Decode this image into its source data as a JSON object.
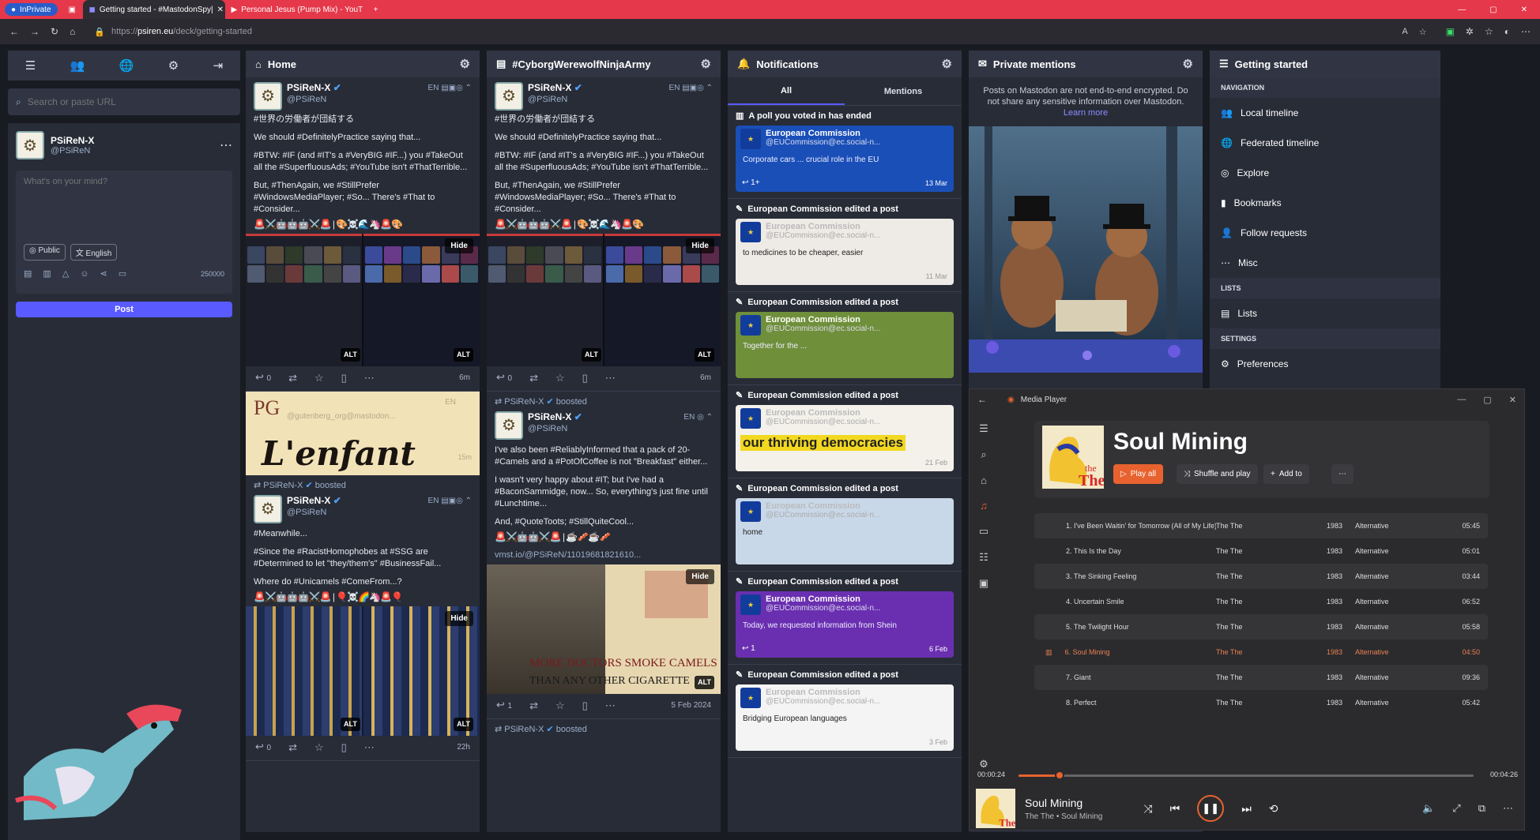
{
  "browser": {
    "inprivate": "InPrivate",
    "tabs": [
      {
        "title": "Getting started - #MastodonSpy|"
      },
      {
        "title": "Personal Jesus (Pump Mix) - YouT"
      }
    ],
    "url_prefix": "https://",
    "url_host": "psiren.eu",
    "url_path": "/deck/getting-started"
  },
  "compose": {
    "search_placeholder": "Search or paste URL",
    "profile_name": "PSiReN-X",
    "profile_handle": "@PSiReN",
    "textarea_placeholder": "What's on your mind?",
    "visibility": "Public",
    "language": "English",
    "char_count": "250000",
    "post_label": "Post"
  },
  "home": {
    "title": "Home",
    "post1": {
      "name": "PSiReN-X",
      "handle": "@PSiReN",
      "lang": "EN",
      "line1": "#世界の労働者が団結する",
      "p1": "We should #DefinitelyPractice saying that...",
      "p2": "#BTW: #IF (and #IT's a #VeryBIG #IF...) you #TakeOut all the #SuperfluousAds; #YouTube isn't #ThatTerrible...",
      "p3": "But, #ThenAgain, we #StillPrefer #WindowsMediaPlayer; #So... There's #That to #Consider...",
      "emoji": "🚨⚔️🤖🤖🤖⚔️🚨 | 🎨☠️🌊🦄🚨🎨",
      "hide": "Hide",
      "alt": "ALT",
      "replies": "0",
      "time": "6m"
    },
    "post2_card": {
      "site": "@gutenberg_org@mastodon...",
      "script": "L'enfant",
      "logo": "PG",
      "time": "15m",
      "lang": "EN"
    },
    "boost_by": "PSiReN-X",
    "boosted": "boosted",
    "post3": {
      "name": "PSiReN-X",
      "handle": "@PSiReN",
      "lang": "EN",
      "p1": "#Meanwhile...",
      "p2": "#Since the #RacistHomophobes at #SSG are #Determined to let \"they/them's\" #BusinessFail...",
      "p3": "Where do #Unicamels #ComeFrom...?",
      "emoji": "🚨⚔️🤖🤖🤖⚔️🚨 | 🎈☠️🌈🦄🚨🎈",
      "hide": "Hide",
      "alt": "ALT",
      "replies": "0",
      "time": "22h"
    }
  },
  "cyborg": {
    "title": "#CyborgWerewolfNinjaArmy",
    "post1": {
      "name": "PSiReN-X",
      "handle": "@PSiReN",
      "lang": "EN",
      "line1": "#世界の労働者が団結する",
      "p1": "We should #DefinitelyPractice saying that...",
      "p2": "#BTW: #IF (and #IT's a #VeryBIG #IF...) you #TakeOut all the #SuperfluousAds; #YouTube isn't #ThatTerrible...",
      "p3": "But, #ThenAgain, we #StillPrefer #WindowsMediaPlayer; #So... There's #That to #Consider...",
      "emoji": "🚨⚔️🤖🤖🤖⚔️🚨 | 🎨☠️🌊🦄🚨🎨",
      "hide": "Hide",
      "alt": "ALT",
      "replies": "0",
      "time": "6m"
    },
    "boost_by": "PSiReN-X",
    "boosted": "boosted",
    "post2": {
      "name": "PSiReN-X",
      "handle": "@PSiReN",
      "lang": "EN",
      "p1": "I've also been #ReliablyInformed that a pack of 20-#Camels and a #PotOfCoffee is not \"Breakfast\" either...",
      "p2": "I wasn't very happy about #IT; but I've had a #BaconSammidge, now... So, everything's just fine until #Lunchtime...",
      "p3": "And, #QuoteToots; #StillQuiteCool...",
      "emoji": "🚨⚔️🤖🤖⚔️🚨 | ☕🥓☕🥓",
      "link": "vmst.io/@PSiReN/11019681821610...",
      "ad1": "MORE DOCTORS SMOKE CAMELS",
      "ad2": "THAN ANY OTHER CIGARETTE",
      "hide": "Hide",
      "alt": "ALT",
      "replies": "1",
      "time": "5 Feb 2024"
    },
    "boost_by2": "PSiReN-X",
    "boosted2": "boosted"
  },
  "notifications": {
    "title": "Notifications",
    "tab_all": "All",
    "tab_mentions": "Mentions",
    "items": [
      {
        "header": "A poll you voted in has ended",
        "name": "European Commission",
        "handle": "@EUCommission@ec.social-n...",
        "overlay": "Corporate cars ... crucial role in the EU",
        "date": "13 Mar",
        "count": "1+",
        "bg": "#1a4fb8"
      },
      {
        "header": "European Commission edited a post",
        "name": "European Commission",
        "handle": "@EUCommission@ec.social-n...",
        "overlay": "to medicines to be cheaper, easier",
        "date": "11 Mar",
        "bg": "#eeeae6"
      },
      {
        "header": "European Commission edited a post",
        "name": "European Commission",
        "handle": "@EUCommission@ec.social-n...",
        "overlay": "Together for the ...",
        "date": "",
        "bg": "#6f8f3a"
      },
      {
        "header": "European Commission edited a post",
        "name": "European Commission",
        "handle": "@EUCommission@ec.social-n...",
        "overlay": "our thriving democracies",
        "date": "21 Feb",
        "bg": "#f3f1ea"
      },
      {
        "header": "European Commission edited a post",
        "name": "European Commission",
        "handle": "@EUCommission@ec.social-n...",
        "overlay": "home",
        "date": "",
        "bg": "#c9d8e8"
      },
      {
        "header": "European Commission edited a post",
        "name": "European Commission",
        "handle": "@EUCommission@ec.social-n...",
        "overlay": "Today, we requested information from Shein",
        "date": "6 Feb",
        "count": "1",
        "bg": "#6a2fb0"
      },
      {
        "header": "European Commission edited a post",
        "name": "European Commission",
        "handle": "@EUCommission@ec.social-n...",
        "overlay": "Bridging European languages",
        "date": "3 Feb",
        "bg": "#f4f4f4"
      }
    ]
  },
  "private": {
    "title": "Private mentions",
    "notice": "Posts on Mastodon are not end-to-end encrypted. Do not share any sensitive information over Mastodon.",
    "learn_more": "Learn more"
  },
  "getting_started": {
    "title": "Getting started",
    "nav_section": "NAVIGATION",
    "local": "Local timeline",
    "federated": "Federated timeline",
    "explore": "Explore",
    "bookmarks": "Bookmarks",
    "follow_requests": "Follow requests",
    "misc": "Misc",
    "lists_section": "LISTS",
    "lists": "Lists",
    "settings_section": "SETTINGS",
    "preferences": "Preferences"
  },
  "media_player": {
    "app_title": "Media Player",
    "album": "Soul Mining",
    "play_all": "Play all",
    "shuffle": "Shuffle and play",
    "add_to": "Add to",
    "tracks": [
      {
        "n": "1.",
        "title": "I've Been Waitin' for Tomorrow (All of My Life)",
        "artist": "The The",
        "year": "1983",
        "genre": "Alternative",
        "dur": "05:45"
      },
      {
        "n": "2.",
        "title": "This Is the Day",
        "artist": "The The",
        "year": "1983",
        "genre": "Alternative",
        "dur": "05:01"
      },
      {
        "n": "3.",
        "title": "The Sinking Feeling",
        "artist": "The The",
        "year": "1983",
        "genre": "Alternative",
        "dur": "03:44"
      },
      {
        "n": "4.",
        "title": "Uncertain Smile",
        "artist": "The The",
        "year": "1983",
        "genre": "Alternative",
        "dur": "06:52"
      },
      {
        "n": "5.",
        "title": "The Twilight Hour",
        "artist": "The The",
        "year": "1983",
        "genre": "Alternative",
        "dur": "05:58"
      },
      {
        "n": "6.",
        "title": "Soul Mining",
        "artist": "The The",
        "year": "1983",
        "genre": "Alternative",
        "dur": "04:50"
      },
      {
        "n": "7.",
        "title": "Giant",
        "artist": "The The",
        "year": "1983",
        "genre": "Alternative",
        "dur": "09:36"
      },
      {
        "n": "8.",
        "title": "Perfect",
        "artist": "The The",
        "year": "1983",
        "genre": "Alternative",
        "dur": "05:42"
      }
    ],
    "current_track_index": 5,
    "elapsed": "00:00:24",
    "total": "00:04:26",
    "progress": 0.09,
    "now_title": "Soul Mining",
    "now_sub": "The The • Soul Mining",
    "accent": "#e8622f"
  },
  "colors": {
    "tabbar": "#e5384a",
    "deck_bg": "#191b22",
    "column_bg": "#282c37",
    "accent": "#595aff"
  }
}
